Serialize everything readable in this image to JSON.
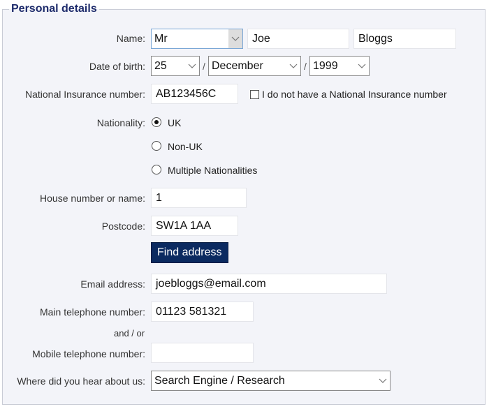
{
  "fieldset": {
    "legend": "Personal details"
  },
  "name": {
    "label": "Name:",
    "title_value": "Mr",
    "first_name": "Joe",
    "last_name": "Bloggs"
  },
  "dob": {
    "label": "Date of birth:",
    "day": "25",
    "month": "December",
    "year": "1999",
    "separator": "/"
  },
  "ni": {
    "label": "National Insurance number:",
    "value": "AB123456C",
    "no_ni_checkbox_label": "I do not have a National Insurance number",
    "no_ni_checked": false
  },
  "nationality": {
    "label": "Nationality:",
    "options": [
      {
        "label": "UK",
        "checked": true
      },
      {
        "label": "Non-UK",
        "checked": false
      },
      {
        "label": "Multiple Nationalities",
        "checked": false
      }
    ]
  },
  "house": {
    "label": "House number or name:",
    "value": "1"
  },
  "postcode": {
    "label": "Postcode:",
    "value": "SW1A 1AA"
  },
  "find_address_button": "Find address",
  "email": {
    "label": "Email address:",
    "value": "joebloggs@email.com"
  },
  "main_phone": {
    "label": "Main telephone number:",
    "value": "01123 581321"
  },
  "and_or": "and / or",
  "mobile_phone": {
    "label": "Mobile telephone number:",
    "value": ""
  },
  "hear_about": {
    "label": "Where did you hear about us:",
    "value": "Search Engine / Research"
  },
  "colors": {
    "legend": "#1d2b6b",
    "button_bg": "#0b2a60",
    "panel_bg": "#f3f4f9"
  }
}
